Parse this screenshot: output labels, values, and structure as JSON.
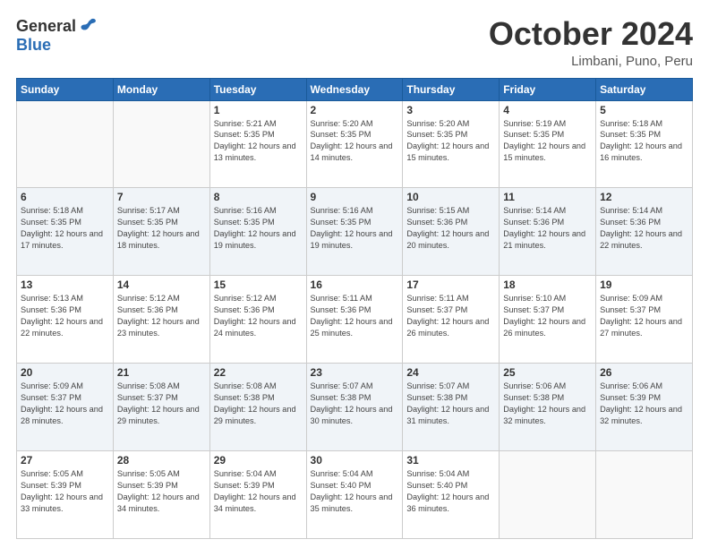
{
  "logo": {
    "general": "General",
    "blue": "Blue"
  },
  "title": "October 2024",
  "location": "Limbani, Puno, Peru",
  "weekdays": [
    "Sunday",
    "Monday",
    "Tuesday",
    "Wednesday",
    "Thursday",
    "Friday",
    "Saturday"
  ],
  "weeks": [
    [
      {
        "day": "",
        "info": ""
      },
      {
        "day": "",
        "info": ""
      },
      {
        "day": "1",
        "info": "Sunrise: 5:21 AM\nSunset: 5:35 PM\nDaylight: 12 hours and 13 minutes."
      },
      {
        "day": "2",
        "info": "Sunrise: 5:20 AM\nSunset: 5:35 PM\nDaylight: 12 hours and 14 minutes."
      },
      {
        "day": "3",
        "info": "Sunrise: 5:20 AM\nSunset: 5:35 PM\nDaylight: 12 hours and 15 minutes."
      },
      {
        "day": "4",
        "info": "Sunrise: 5:19 AM\nSunset: 5:35 PM\nDaylight: 12 hours and 15 minutes."
      },
      {
        "day": "5",
        "info": "Sunrise: 5:18 AM\nSunset: 5:35 PM\nDaylight: 12 hours and 16 minutes."
      }
    ],
    [
      {
        "day": "6",
        "info": "Sunrise: 5:18 AM\nSunset: 5:35 PM\nDaylight: 12 hours and 17 minutes."
      },
      {
        "day": "7",
        "info": "Sunrise: 5:17 AM\nSunset: 5:35 PM\nDaylight: 12 hours and 18 minutes."
      },
      {
        "day": "8",
        "info": "Sunrise: 5:16 AM\nSunset: 5:35 PM\nDaylight: 12 hours and 19 minutes."
      },
      {
        "day": "9",
        "info": "Sunrise: 5:16 AM\nSunset: 5:35 PM\nDaylight: 12 hours and 19 minutes."
      },
      {
        "day": "10",
        "info": "Sunrise: 5:15 AM\nSunset: 5:36 PM\nDaylight: 12 hours and 20 minutes."
      },
      {
        "day": "11",
        "info": "Sunrise: 5:14 AM\nSunset: 5:36 PM\nDaylight: 12 hours and 21 minutes."
      },
      {
        "day": "12",
        "info": "Sunrise: 5:14 AM\nSunset: 5:36 PM\nDaylight: 12 hours and 22 minutes."
      }
    ],
    [
      {
        "day": "13",
        "info": "Sunrise: 5:13 AM\nSunset: 5:36 PM\nDaylight: 12 hours and 22 minutes."
      },
      {
        "day": "14",
        "info": "Sunrise: 5:12 AM\nSunset: 5:36 PM\nDaylight: 12 hours and 23 minutes."
      },
      {
        "day": "15",
        "info": "Sunrise: 5:12 AM\nSunset: 5:36 PM\nDaylight: 12 hours and 24 minutes."
      },
      {
        "day": "16",
        "info": "Sunrise: 5:11 AM\nSunset: 5:36 PM\nDaylight: 12 hours and 25 minutes."
      },
      {
        "day": "17",
        "info": "Sunrise: 5:11 AM\nSunset: 5:37 PM\nDaylight: 12 hours and 26 minutes."
      },
      {
        "day": "18",
        "info": "Sunrise: 5:10 AM\nSunset: 5:37 PM\nDaylight: 12 hours and 26 minutes."
      },
      {
        "day": "19",
        "info": "Sunrise: 5:09 AM\nSunset: 5:37 PM\nDaylight: 12 hours and 27 minutes."
      }
    ],
    [
      {
        "day": "20",
        "info": "Sunrise: 5:09 AM\nSunset: 5:37 PM\nDaylight: 12 hours and 28 minutes."
      },
      {
        "day": "21",
        "info": "Sunrise: 5:08 AM\nSunset: 5:37 PM\nDaylight: 12 hours and 29 minutes."
      },
      {
        "day": "22",
        "info": "Sunrise: 5:08 AM\nSunset: 5:38 PM\nDaylight: 12 hours and 29 minutes."
      },
      {
        "day": "23",
        "info": "Sunrise: 5:07 AM\nSunset: 5:38 PM\nDaylight: 12 hours and 30 minutes."
      },
      {
        "day": "24",
        "info": "Sunrise: 5:07 AM\nSunset: 5:38 PM\nDaylight: 12 hours and 31 minutes."
      },
      {
        "day": "25",
        "info": "Sunrise: 5:06 AM\nSunset: 5:38 PM\nDaylight: 12 hours and 32 minutes."
      },
      {
        "day": "26",
        "info": "Sunrise: 5:06 AM\nSunset: 5:39 PM\nDaylight: 12 hours and 32 minutes."
      }
    ],
    [
      {
        "day": "27",
        "info": "Sunrise: 5:05 AM\nSunset: 5:39 PM\nDaylight: 12 hours and 33 minutes."
      },
      {
        "day": "28",
        "info": "Sunrise: 5:05 AM\nSunset: 5:39 PM\nDaylight: 12 hours and 34 minutes."
      },
      {
        "day": "29",
        "info": "Sunrise: 5:04 AM\nSunset: 5:39 PM\nDaylight: 12 hours and 34 minutes."
      },
      {
        "day": "30",
        "info": "Sunrise: 5:04 AM\nSunset: 5:40 PM\nDaylight: 12 hours and 35 minutes."
      },
      {
        "day": "31",
        "info": "Sunrise: 5:04 AM\nSunset: 5:40 PM\nDaylight: 12 hours and 36 minutes."
      },
      {
        "day": "",
        "info": ""
      },
      {
        "day": "",
        "info": ""
      }
    ]
  ]
}
